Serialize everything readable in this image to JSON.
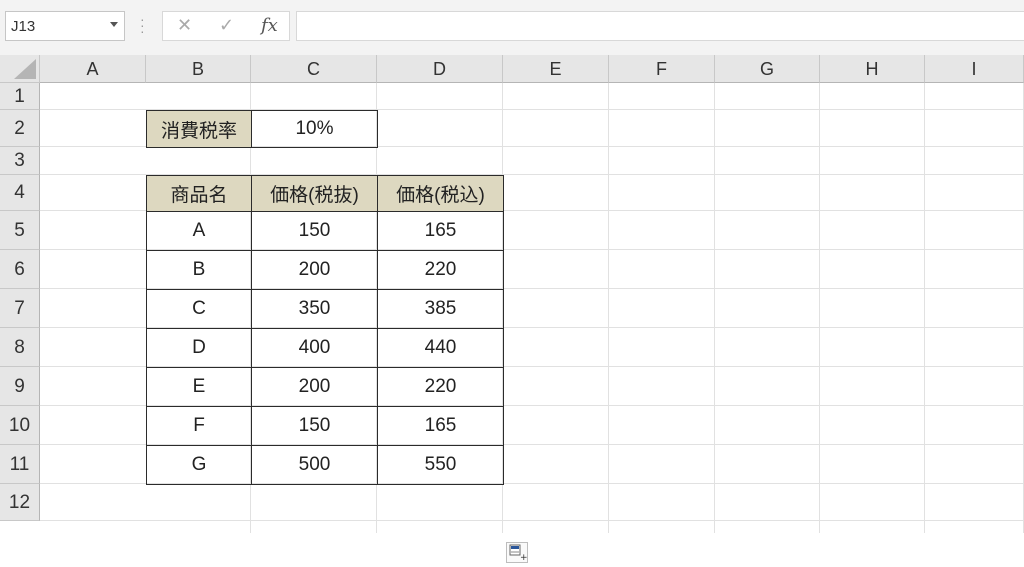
{
  "name_box": {
    "value": "J13"
  },
  "formula_bar": {
    "cancel_icon": "✕",
    "enter_icon": "✓",
    "fx_label": "fx",
    "value": ""
  },
  "columns": [
    "A",
    "B",
    "C",
    "D",
    "E",
    "F",
    "G",
    "H",
    "I"
  ],
  "rows": [
    "1",
    "2",
    "3",
    "4",
    "5",
    "6",
    "7",
    "8",
    "9",
    "10",
    "11",
    "12"
  ],
  "tax": {
    "label": "消費税率",
    "value": "10%"
  },
  "table": {
    "headers": [
      "商品名",
      "価格(税抜)",
      "価格(税込)"
    ],
    "rows": [
      [
        "A",
        "150",
        "165"
      ],
      [
        "B",
        "200",
        "220"
      ],
      [
        "C",
        "350",
        "385"
      ],
      [
        "D",
        "400",
        "440"
      ],
      [
        "E",
        "200",
        "220"
      ],
      [
        "F",
        "150",
        "165"
      ],
      [
        "G",
        "500",
        "550"
      ]
    ]
  },
  "colors": {
    "header_fill": "#ddd8c0",
    "border": "#2b2b2b",
    "gridline": "#e1e1e1"
  },
  "icons": {
    "paste_options": "paste-options-icon"
  }
}
